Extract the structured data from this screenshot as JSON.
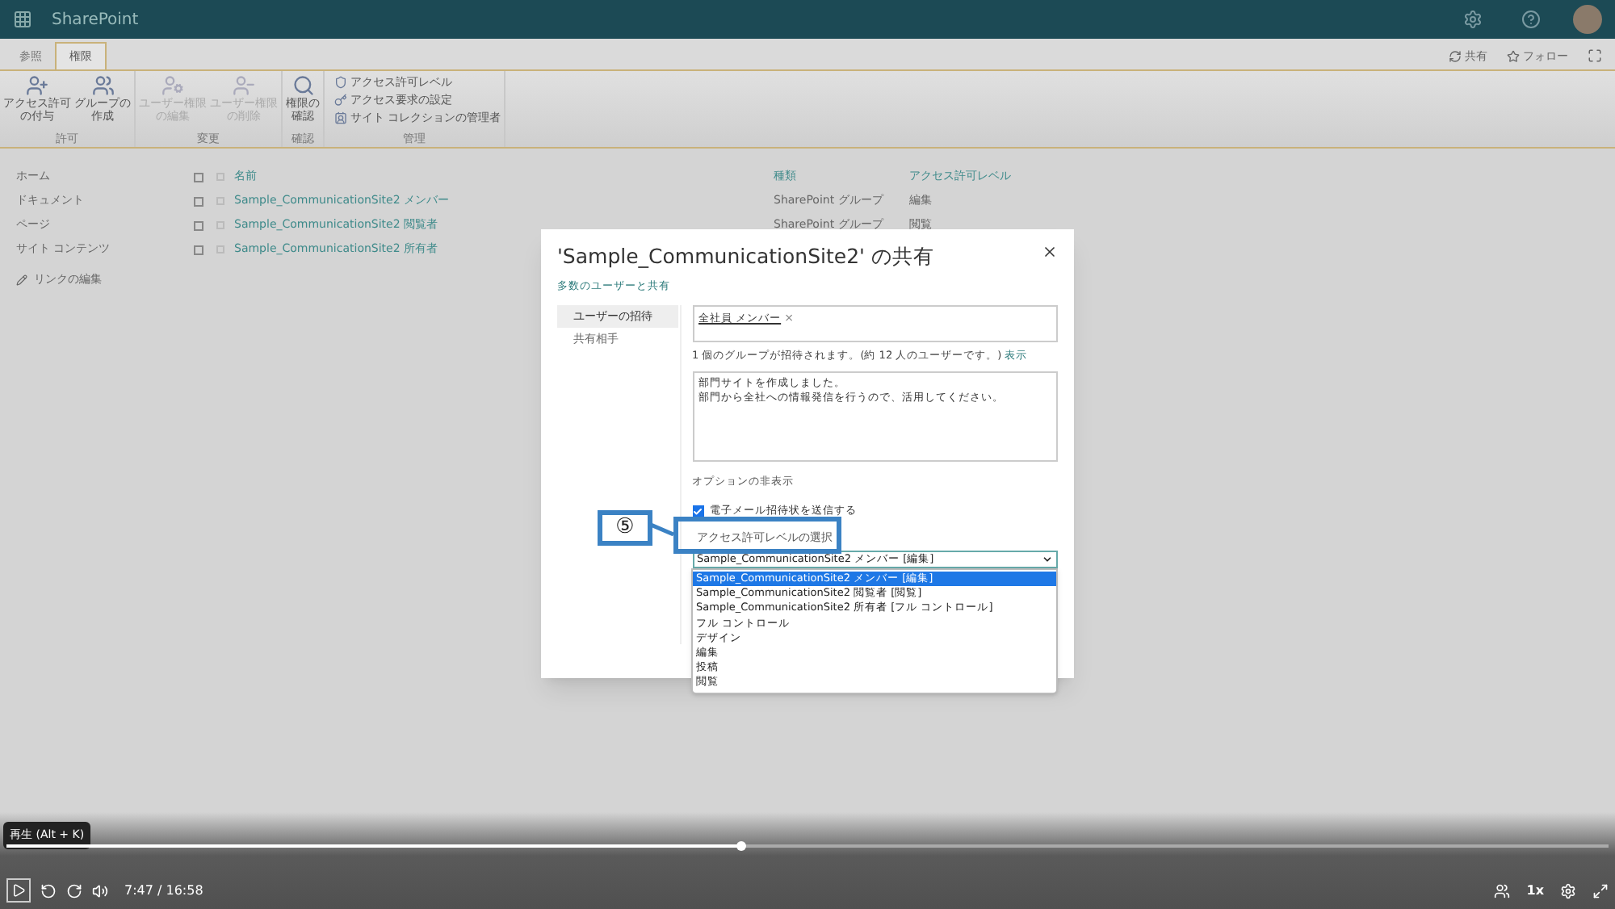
{
  "app": {
    "name": "SharePoint"
  },
  "ribbon": {
    "tabs": [
      {
        "label": "参照",
        "selected": false
      },
      {
        "label": "権限",
        "selected": true
      }
    ],
    "actions": [
      {
        "label": "共有"
      },
      {
        "label": "フォロー"
      }
    ],
    "groups": [
      {
        "label": "許可",
        "buttons": [
          {
            "lines": [
              "アクセス許可",
              "の付与"
            ],
            "disabled": false
          },
          {
            "lines": [
              "グループの",
              "作成"
            ],
            "disabled": false
          }
        ]
      },
      {
        "label": "変更",
        "buttons": [
          {
            "lines": [
              "ユーザー権限",
              "の編集"
            ],
            "disabled": true
          },
          {
            "lines": [
              "ユーザー権限",
              "の削除"
            ],
            "disabled": true
          }
        ]
      },
      {
        "label": "確認",
        "buttons": [
          {
            "lines": [
              "権限の",
              "確認"
            ],
            "disabled": false
          }
        ]
      },
      {
        "label": "管理",
        "small_buttons": [
          "アクセス許可レベル",
          "アクセス要求の設定",
          "サイト コレクションの管理者"
        ]
      }
    ]
  },
  "nav": {
    "items": [
      "ホーム",
      "ドキュメント",
      "ページ",
      "サイト コンテンツ"
    ],
    "edit_links": "リンクの編集"
  },
  "table": {
    "select_all": {
      "checked": false
    },
    "columns": [
      "名前",
      "種類",
      "アクセス許可レベル"
    ],
    "rows": [
      {
        "name": "Sample_CommunicationSite2 メンバー",
        "type": "SharePoint グループ",
        "level": "編集",
        "checked": false
      },
      {
        "name": "Sample_CommunicationSite2 閲覧者",
        "type": "SharePoint グループ",
        "level": "閲覧",
        "checked": false
      },
      {
        "name": "Sample_CommunicationSite2 所有者",
        "checked": false
      }
    ]
  },
  "dialog": {
    "title": "'Sample_CommunicationSite2' の共有",
    "subtitle": "多数のユーザーと共有",
    "side_tabs": [
      {
        "label": "ユーザーの招待",
        "selected": true
      },
      {
        "label": "共有相手",
        "selected": false
      }
    ],
    "people": [
      {
        "name": "全社員 メンバー"
      }
    ],
    "remove": "×",
    "info": "1 個のグループが招待されます。(約 12 人のユーザーです。)",
    "info_link": "表示",
    "message": [
      "部門サイトを作成しました。",
      "部門から全社への情報発信を行うので、活用してください。"
    ],
    "options_toggle": "オプションの非表示",
    "send_email": {
      "label": "電子メール招待状を送信する",
      "checked": true
    },
    "select_label": "アクセス許可レベルの選択",
    "select_value": "Sample_CommunicationSite2 メンバー [編集]",
    "options": [
      {
        "label": "Sample_CommunicationSite2 メンバー [編集]",
        "selected": true
      },
      {
        "label": "Sample_CommunicationSite2 閲覧者 [閲覧]",
        "selected": false
      },
      {
        "label": "Sample_CommunicationSite2 所有者 [フル コントロール]",
        "selected": false
      },
      {
        "label": "フル コントロール",
        "selected": false
      },
      {
        "label": "デザイン",
        "selected": false
      },
      {
        "label": "編集",
        "selected": false
      },
      {
        "label": "投稿",
        "selected": false
      },
      {
        "label": "閲覧",
        "selected": false
      }
    ]
  },
  "annotation": {
    "label": "⑤"
  },
  "player": {
    "tooltip": "再生 (Alt + K)",
    "time": "7:47 / 16:58",
    "speed": "1x",
    "level": 0.459
  }
}
